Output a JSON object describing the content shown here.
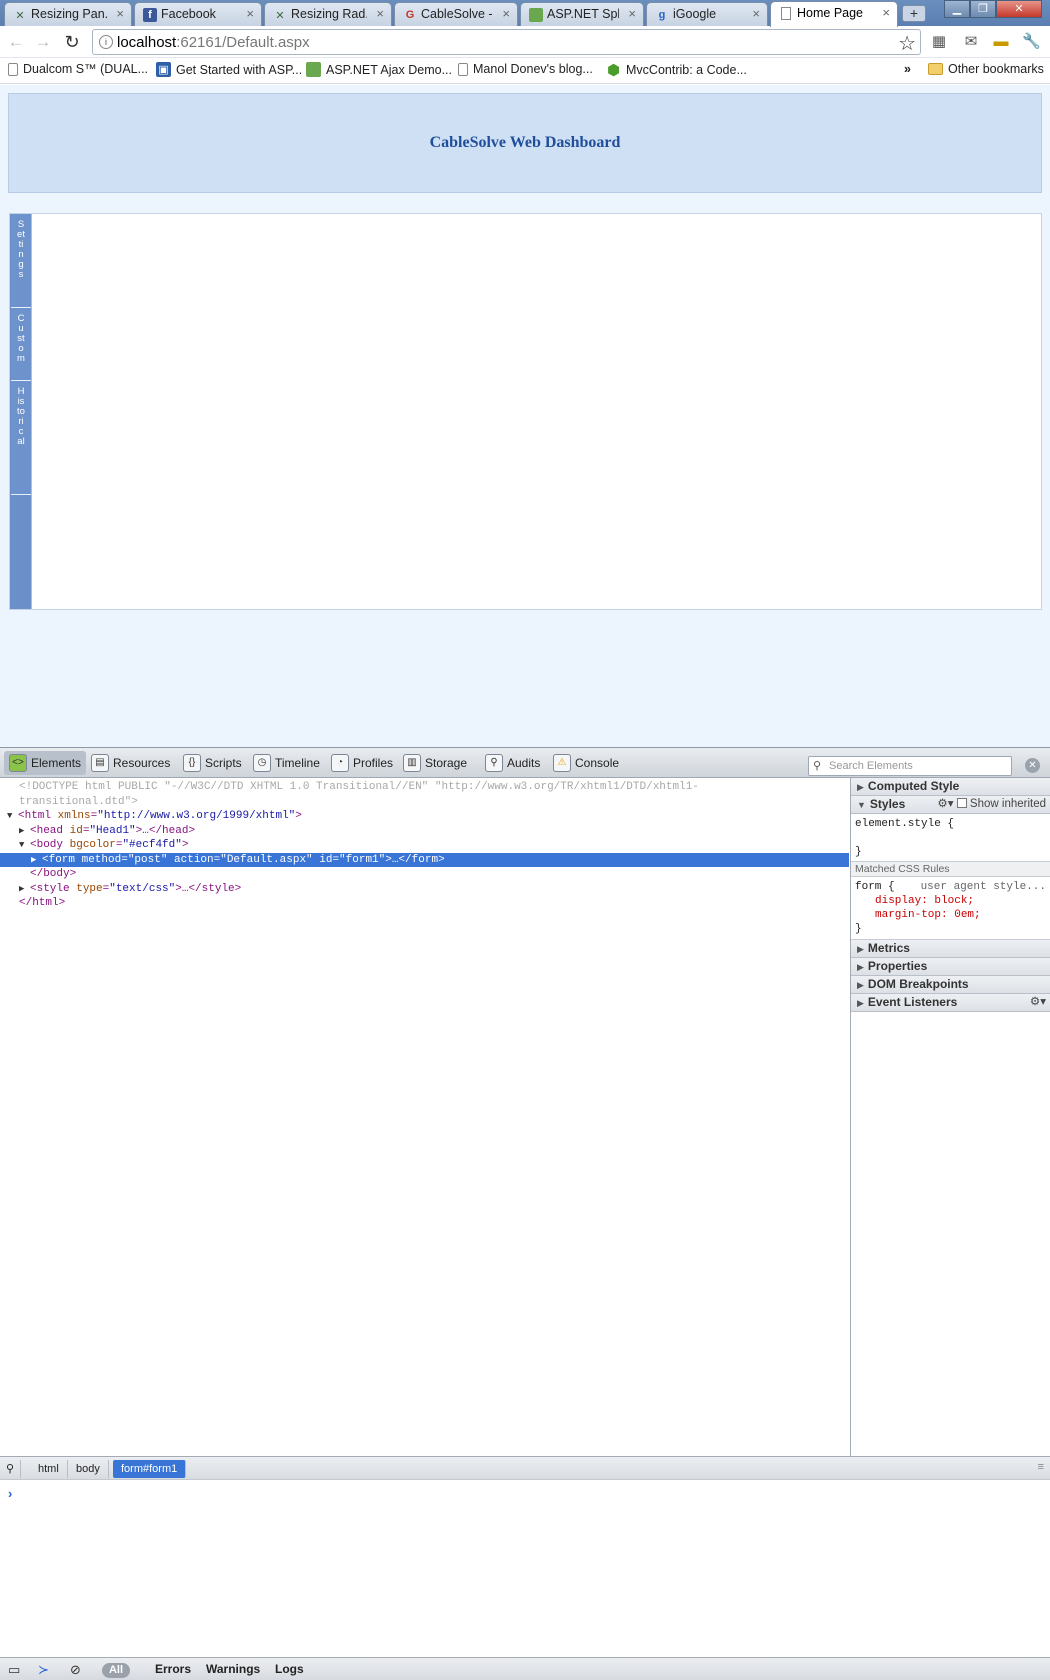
{
  "browser": {
    "tabs": [
      {
        "label": "Resizing Pan...",
        "icon": "telerik-icon"
      },
      {
        "label": "Facebook",
        "icon": "facebook-icon"
      },
      {
        "label": "Resizing Rad...",
        "icon": "telerik-icon"
      },
      {
        "label": "CableSolve -...",
        "icon": "google-icon"
      },
      {
        "label": "ASP.NET Spl...",
        "icon": "aspnet-icon"
      },
      {
        "label": "iGoogle",
        "icon": "google-icon"
      },
      {
        "label": "Home Page",
        "icon": "page-icon",
        "active": true
      }
    ],
    "new_tab": "+",
    "address": {
      "host": "localhost",
      "rest": ":62161/Default.aspx"
    },
    "bookmarks": [
      {
        "label": "Dualcom S™ (DUAL...",
        "icon": "page-icon"
      },
      {
        "label": "Get Started with ASP...",
        "icon": "aspnet-icon"
      },
      {
        "label": "ASP.NET Ajax Demo...",
        "icon": "telerik-icon"
      },
      {
        "label": "Manol Donev's blog...",
        "icon": "page-icon"
      },
      {
        "label": "MvcContrib: a Code...",
        "icon": "hex-icon"
      }
    ],
    "bookmarks_overflow": "»",
    "other_bookmarks": "Other bookmarks"
  },
  "page": {
    "title": "CableSolve Web Dashboard",
    "side_tabs": [
      "Settings",
      "Custom",
      "Historical"
    ],
    "background": "#ecf4fd"
  },
  "devtools": {
    "panels": [
      "Elements",
      "Resources",
      "Scripts",
      "Timeline",
      "Profiles",
      "Storage",
      "Audits",
      "Console"
    ],
    "active_panel": "Elements",
    "search_placeholder": "Search Elements",
    "dom": {
      "doctype1": "<!DOCTYPE html PUBLIC \"-//W3C//DTD XHTML 1.0 Transitional//EN\" \"http://www.w3.org/TR/xhtml1/DTD/xhtml1-",
      "doctype2": "transitional.dtd\">",
      "html_open_tag": "<html",
      "html_attr": "xmlns",
      "html_val": "\"http://www.w3.org/1999/xhtml\"",
      "head_tag": "<head",
      "head_attr": "id",
      "head_val": "\"Head1\"",
      "head_close": ">…</head>",
      "body_tag": "<body",
      "body_attr": "bgcolor",
      "body_val": "\"#ecf4fd\"",
      "form_line": "<form method=\"post\" action=\"Default.aspx\" id=\"form1\">…</form>",
      "body_close": "</body>",
      "style_tag": "<style",
      "style_attr": "type",
      "style_val": "\"text/css\"",
      "style_close": ">…</style>",
      "html_close": "</html>"
    },
    "sidebar": {
      "computed_style": "Computed Style",
      "styles": "Styles",
      "show_inherited": "Show inherited",
      "element_style_open": "element.style {",
      "element_style_close": "}",
      "matched_rules": "Matched CSS Rules",
      "form_selector": "form {",
      "ua_label": "user agent style...",
      "prop1": "display: block;",
      "prop2": "margin-top: 0em;",
      "form_close": "}",
      "sections": [
        "Metrics",
        "Properties",
        "DOM Breakpoints",
        "Event Listeners"
      ]
    },
    "breadcrumbs": [
      "html",
      "body",
      "form#form1"
    ],
    "active_breadcrumb": "form#form1",
    "console_prompt": "›",
    "filters": {
      "all": "All",
      "errors": "Errors",
      "warnings": "Warnings",
      "logs": "Logs"
    },
    "selection_color": "#3875d7"
  }
}
